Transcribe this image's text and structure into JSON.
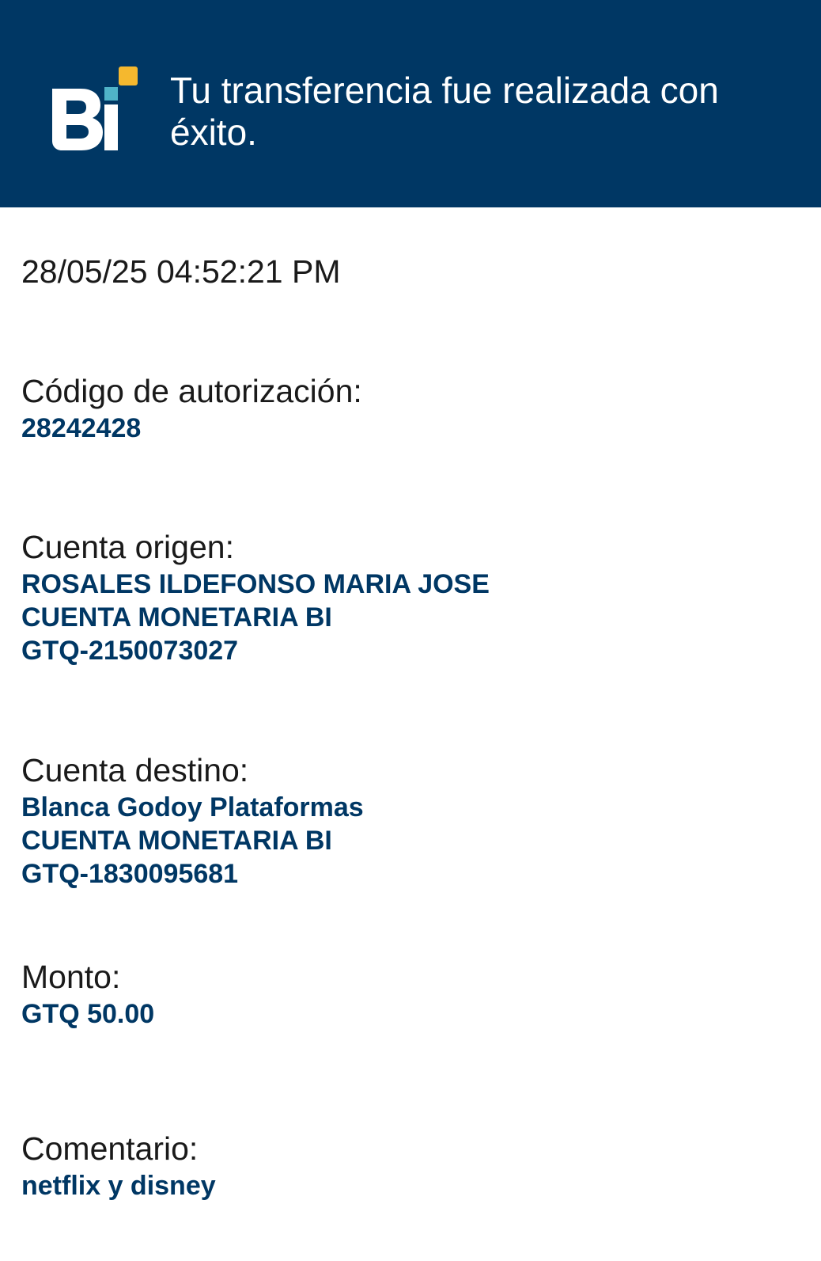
{
  "header": {
    "title": "Tu transferencia fue realizada con éxito.",
    "logo_alt": "Bi",
    "background_color": "#003764",
    "accent_teal": "#4fb3c8",
    "accent_yellow": "#f5b82e"
  },
  "receipt": {
    "datetime": "28/05/25 04:52:21 PM",
    "authorization": {
      "label": "Código de autorización:",
      "value": "28242428"
    },
    "origin": {
      "label": "Cuenta origen:",
      "name": "ROSALES ILDEFONSO MARIA JOSE",
      "account_type": "CUENTA MONETARIA BI",
      "account_number": "GTQ-2150073027"
    },
    "destination": {
      "label": "Cuenta destino:",
      "name": "Blanca Godoy Plataformas",
      "account_type": "CUENTA MONETARIA BI",
      "account_number": "GTQ-1830095681"
    },
    "amount": {
      "label": "Monto:",
      "value": "GTQ 50.00"
    },
    "comment": {
      "label": "Comentario:",
      "value": "netflix y disney"
    }
  }
}
